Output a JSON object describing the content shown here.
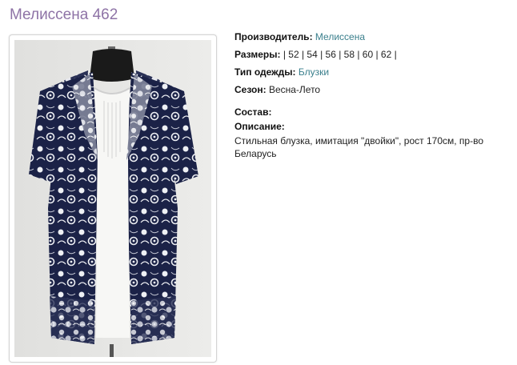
{
  "product": {
    "title": "Мелиссена 462"
  },
  "details": {
    "manufacturer_label": "Производитель:",
    "manufacturer_value": "Мелиссена",
    "sizes_label": "Размеры:",
    "sizes_value": "| 52 | 54 | 56 | 58 | 60 | 62 |",
    "type_label": "Тип одежды:",
    "type_value": "Блузки",
    "season_label": "Сезон:",
    "season_value": "Весна-Лето",
    "composition_label": "Состав:",
    "description_label": "Описание:",
    "description_text": "Стильная блузка, имитация \"двойки\", рост 170см, пр-во Беларусь"
  },
  "colors": {
    "title": "#8e73a6",
    "link": "#3a7f8c",
    "garment_navy": "#1b2247",
    "garment_white": "#f7f7f5"
  }
}
